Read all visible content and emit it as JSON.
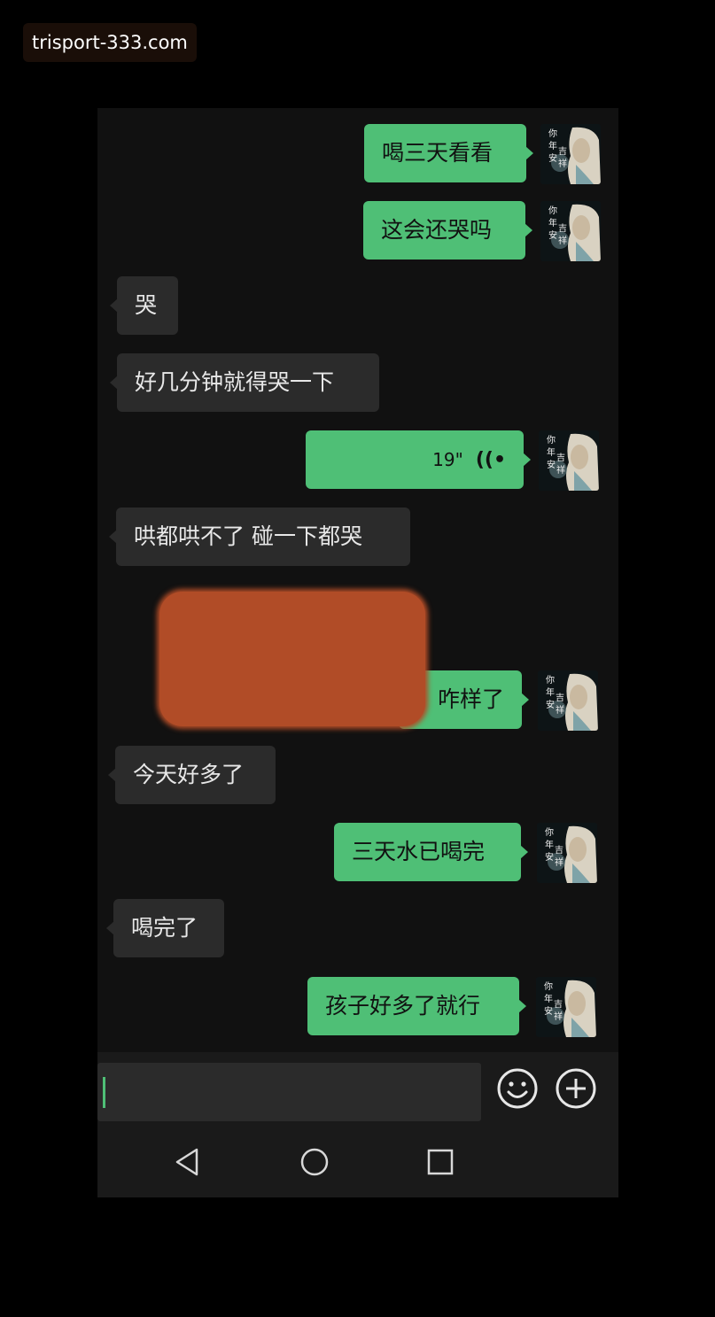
{
  "watermark": "trisport-333.com",
  "messages": [
    {
      "side": "out",
      "text": "喝三天看看"
    },
    {
      "side": "out",
      "text": "这会还哭吗"
    },
    {
      "side": "in",
      "text": "哭"
    },
    {
      "side": "in",
      "text": "好几分钟就得哭一下"
    },
    {
      "side": "out",
      "type": "voice",
      "duration": "19\""
    },
    {
      "side": "in",
      "text": "哄都哄不了 碰一下都哭"
    },
    {
      "side": "out",
      "text": "咋样了",
      "partially_redacted": true
    },
    {
      "side": "in",
      "text": "今天好多了"
    },
    {
      "side": "out",
      "text": "三天水已喝完"
    },
    {
      "side": "in",
      "text": "喝完了"
    },
    {
      "side": "out",
      "text": "孩子好多了就行"
    }
  ],
  "avatar_text": "你年安吉祥",
  "colors": {
    "outgoing_bubble": "#4fbf76",
    "incoming_bubble": "#2b2b2b",
    "chat_background": "#111111",
    "redaction": "#b14c27"
  },
  "input_bar": {
    "value": "",
    "emoji_icon": "smiley-icon",
    "plus_icon": "plus-circle-icon"
  },
  "nav_bar": [
    "back-triangle-icon",
    "home-circle-icon",
    "recents-square-icon"
  ]
}
